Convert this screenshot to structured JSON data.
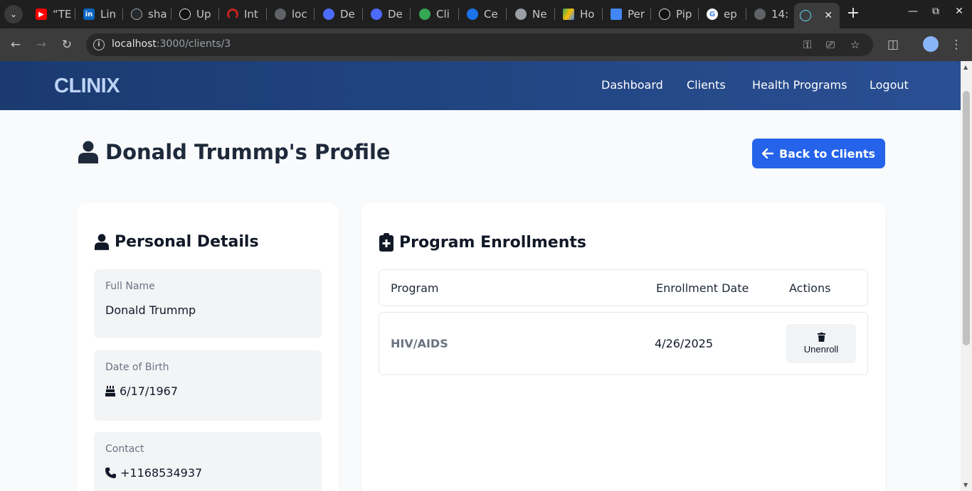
{
  "browser": {
    "tabs": [
      {
        "label": "“TE",
        "icon": "youtube-icon",
        "color": "#ff0000"
      },
      {
        "label": "Lin",
        "icon": "linkedin-icon",
        "color": "#0a66c2"
      },
      {
        "label": "sha",
        "icon": "github-icon",
        "color": "#24292e"
      },
      {
        "label": "Up",
        "icon": "openai-icon",
        "color": "#111111"
      },
      {
        "label": "Int",
        "icon": "gauge-icon",
        "color": "#c5221f"
      },
      {
        "label": "loc",
        "icon": "globe-icon",
        "color": "#5f6368"
      },
      {
        "label": "De",
        "icon": "deepseek-icon",
        "color": "#4d6bfe"
      },
      {
        "label": "De",
        "icon": "deepseek-icon",
        "color": "#4d6bfe"
      },
      {
        "label": "Cli",
        "icon": "clinix-icon",
        "color": "#34a853"
      },
      {
        "label": "Ce",
        "icon": "cloud-icon",
        "color": "#1a73e8"
      },
      {
        "label": "Ne",
        "icon": "chrome-icon",
        "color": "#5f6368"
      },
      {
        "label": "Ho",
        "icon": "drive-icon",
        "color": "#fbbc04"
      },
      {
        "label": "Per",
        "icon": "docs-icon",
        "color": "#4285f4"
      },
      {
        "label": "Pip",
        "icon": "openai-icon",
        "color": "#111111"
      },
      {
        "label": "ep",
        "icon": "google-icon",
        "color": "#ffffff"
      },
      {
        "label": "14:",
        "icon": "globe-icon",
        "color": "#5f6368"
      }
    ],
    "active_tab_icon": "react-icon",
    "url_host": "localhost",
    "url_path": ":3000/clients/3"
  },
  "nav": {
    "brand": "CLINIX",
    "links": [
      "Dashboard",
      "Clients",
      "Health Programs",
      "Logout"
    ]
  },
  "page": {
    "title": "Donald Trummp's Profile",
    "back_button": "Back to Clients"
  },
  "personal": {
    "title": "Personal Details",
    "fields": [
      {
        "label": "Full Name",
        "value": "Donald Trummp"
      },
      {
        "label": "Date of Birth",
        "value": "6/17/1967"
      },
      {
        "label": "Contact",
        "value": "+1168534937"
      }
    ]
  },
  "enrollments": {
    "title": "Program Enrollments",
    "columns": [
      "Program",
      "Enrollment Date",
      "Actions"
    ],
    "rows": [
      {
        "program": "HIV/AIDS",
        "date": "4/26/2025",
        "action": "Unenroll"
      }
    ]
  }
}
